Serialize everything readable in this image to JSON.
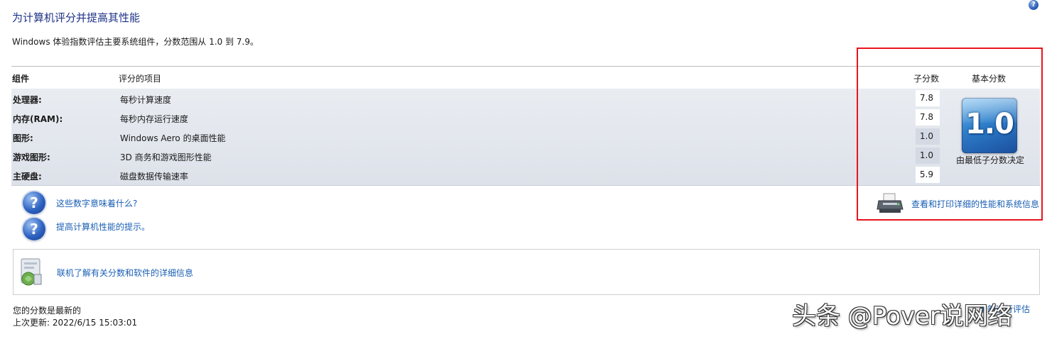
{
  "header": {
    "title": "为计算机评分并提高其性能",
    "subtitle": "Windows 体验指数评估主要系统组件，分数范围从 1.0 到 7.9。",
    "help_glyph": "?"
  },
  "table": {
    "columns": {
      "component": "组件",
      "rated_item": "评分的项目",
      "subscore": "子分数",
      "base_score": "基本分数"
    },
    "rows": [
      {
        "component": "处理器:",
        "description": "每秒计算速度",
        "subscore": "7.8"
      },
      {
        "component": "内存(RAM):",
        "description": "每秒内存运行速度",
        "subscore": "7.8"
      },
      {
        "component": "图形:",
        "description": "Windows Aero 的桌面性能",
        "subscore": "1.0"
      },
      {
        "component": "游戏图形:",
        "description": "3D 商务和游戏图形性能",
        "subscore": "1.0"
      },
      {
        "component": "主硬盘:",
        "description": "磁盘数据传输速率",
        "subscore": "5.9"
      }
    ],
    "base_score": {
      "value": "1.0",
      "note": "由最低子分数决定"
    }
  },
  "links": {
    "what_numbers_mean": "这些数字意味着什么?",
    "improve_tips": "提高计算机性能的提示。",
    "view_print_details": "查看和打印详细的性能和系统信息",
    "online_info": "联机了解有关分数和软件的详细信息"
  },
  "icons": {
    "help": "question-circle-icon",
    "printer": "printer-icon",
    "online": "online-info-icon"
  },
  "status": {
    "current": "您的分数是最新的",
    "last_update": "上次更新: 2022/6/15 15:03:01",
    "rerun_label": "重新运行评估"
  },
  "watermark": "头条 @Pover说网络",
  "colors": {
    "title": "#1e3287",
    "link": "#1a5fb4",
    "highlight_border": "#e8141d",
    "tile_blue": "#2f7fcb"
  }
}
